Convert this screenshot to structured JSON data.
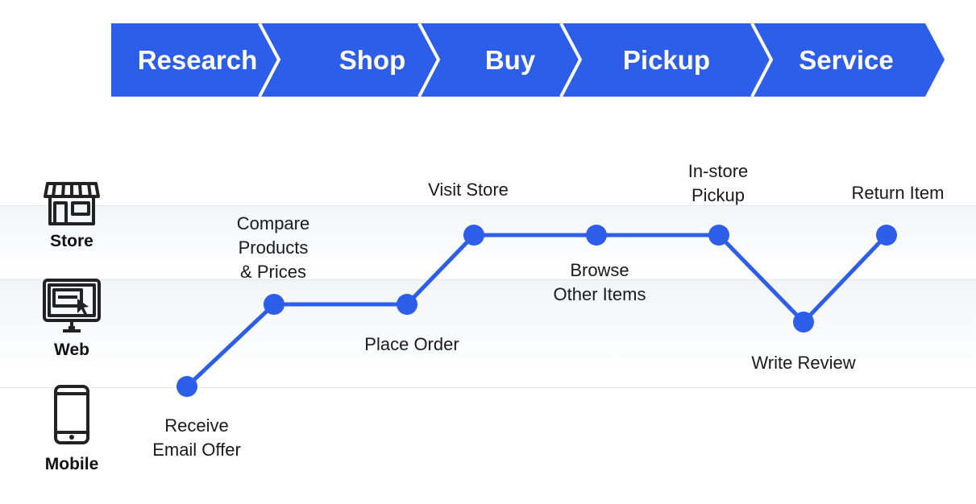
{
  "colors": {
    "accent": "#2d5eea",
    "stage_divider": "#ffffff",
    "text": "#1a1a1a",
    "icon": "#222222"
  },
  "stages": [
    {
      "label": "Research"
    },
    {
      "label": "Shop"
    },
    {
      "label": "Buy"
    },
    {
      "label": "Pickup"
    },
    {
      "label": "Service"
    }
  ],
  "channels": [
    {
      "label": "Store",
      "icon": "store-icon"
    },
    {
      "label": "Web",
      "icon": "web-icon"
    },
    {
      "label": "Mobile",
      "icon": "mobile-phone-icon"
    }
  ],
  "touchpoints": [
    {
      "label": "Receive\nEmail Offer",
      "channel": "Mobile"
    },
    {
      "label": "Compare\nProducts\n& Prices",
      "channel": "Web"
    },
    {
      "label": "Place Order",
      "channel": "Web"
    },
    {
      "label": "Visit Store",
      "channel": "Store"
    },
    {
      "label": "Browse\nOther Items",
      "channel": "Store"
    },
    {
      "label": "In-store\nPickup",
      "channel": "Store"
    },
    {
      "label": "Write Review",
      "channel": "Web"
    },
    {
      "label": "Return Item",
      "channel": "Store"
    }
  ]
}
